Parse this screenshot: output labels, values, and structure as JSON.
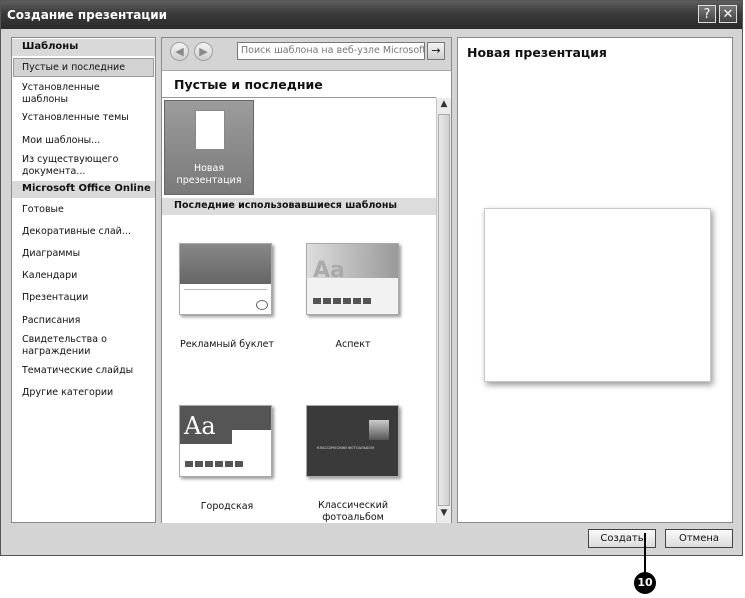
{
  "window": {
    "title": "Создание презентации",
    "help_label": "?",
    "close_label": "✕"
  },
  "sidebar": {
    "header_templates": "Шаблоны",
    "items_templates": [
      "Пустые и последние",
      "Установленные шаблоны",
      "Установленные темы",
      "Мои шаблоны...",
      "Из существующего документа..."
    ],
    "header_online": "Microsoft Office Online",
    "items_online": [
      "Готовые",
      "Декоративные слай...",
      "Диаграммы",
      "Календари",
      "Презентации",
      "Расписания",
      "Свидетельства о награждении",
      "Тематические слайды",
      "Другие категории"
    ],
    "selected": "Пустые и последние"
  },
  "toolbar": {
    "back_icon": "arrow-left-icon",
    "forward_icon": "arrow-right-icon",
    "search_placeholder": "Поиск шаблона на веб-узле Microsoft",
    "go_icon": "arrow-right-icon"
  },
  "gallery": {
    "title": "Пустые и последние",
    "new_presentation_label": "Новая презентация",
    "recent_header": "Последние использовавшиеся шаблоны",
    "templates": [
      {
        "label": "Рекламный буклет"
      },
      {
        "label": "Аспект",
        "thumb_text": "Aa"
      },
      {
        "label": "Городская",
        "thumb_text": "Aa"
      },
      {
        "label": "Классический фотоальбом",
        "thumb_text": "КЛАССИЧЕСКИЙ ФОТОАЛЬБОМ"
      }
    ]
  },
  "preview": {
    "title": "Новая презентация"
  },
  "buttons": {
    "create": "Создать",
    "cancel": "Отмена"
  },
  "callout": {
    "number": "10"
  }
}
